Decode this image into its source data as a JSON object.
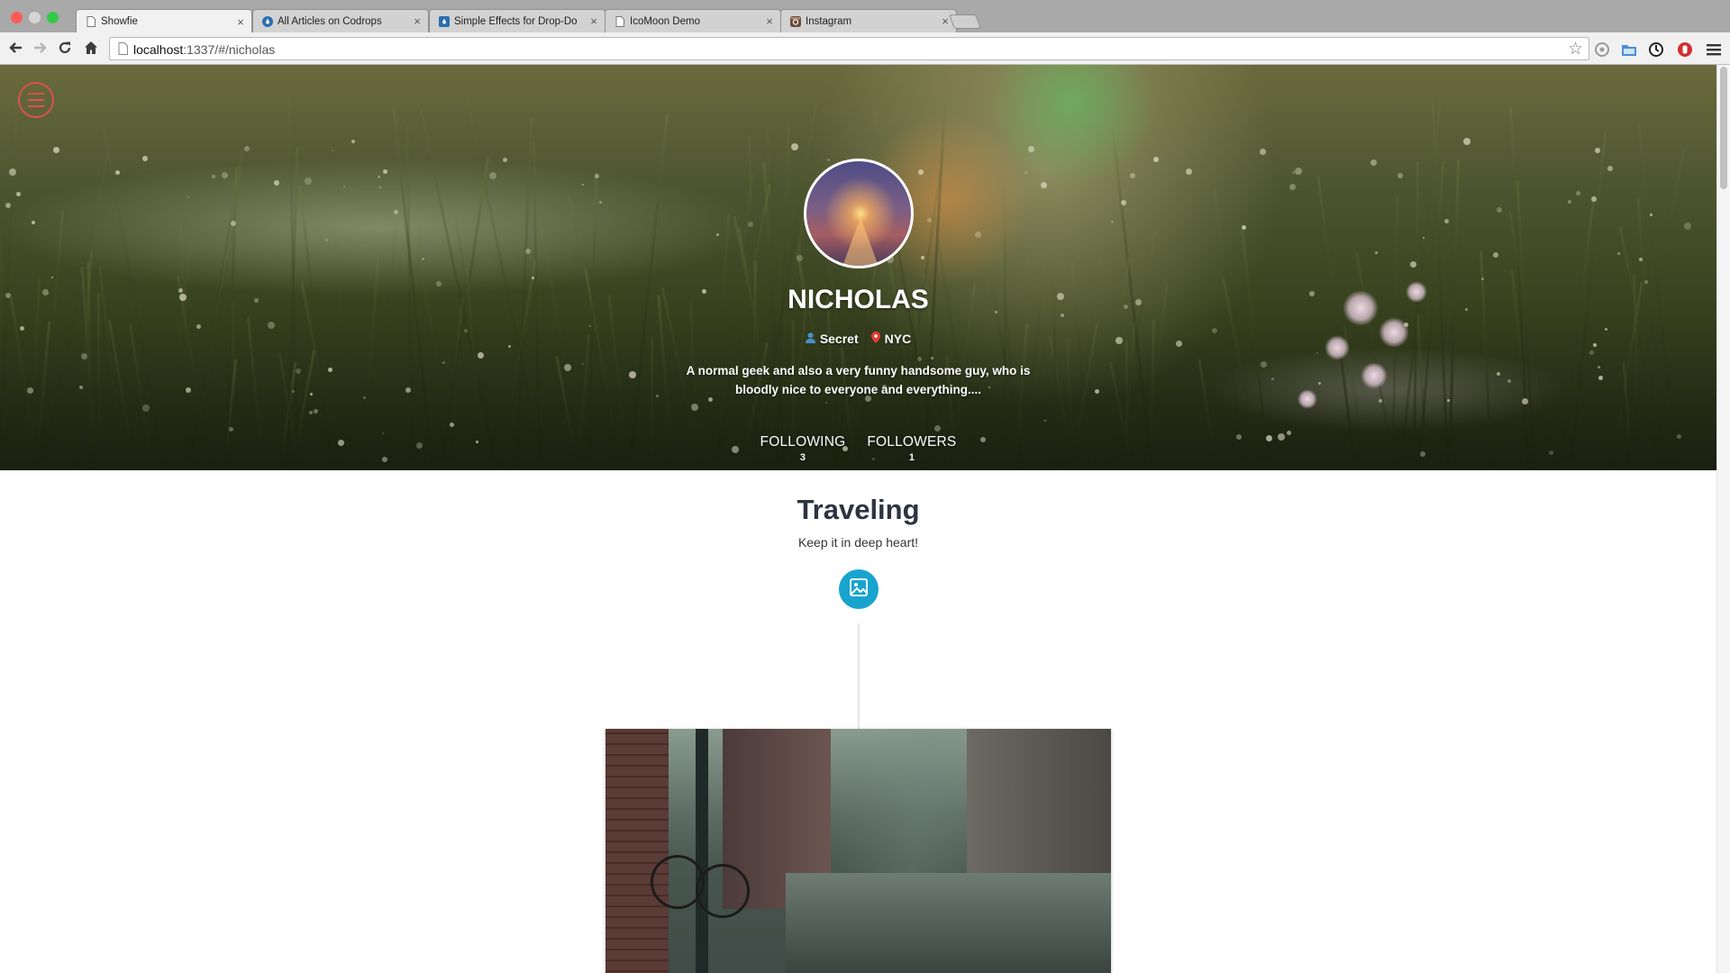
{
  "browser": {
    "tabs": [
      {
        "title": "Showfie",
        "favicon": "page-icon",
        "active": true
      },
      {
        "title": "All Articles on Codrops",
        "favicon": "codrops-drop-icon",
        "active": false
      },
      {
        "title": "Simple Effects for Drop-Do",
        "favicon": "codrops-drop-icon",
        "active": false
      },
      {
        "title": "IcoMoon Demo",
        "favicon": "page-icon",
        "active": false
      },
      {
        "title": "Instagram",
        "favicon": "instagram-icon",
        "active": false
      }
    ],
    "url_host": "localhost",
    "url_rest": ":1337/#/nicholas"
  },
  "profile": {
    "name": "NICHOLAS",
    "gender": "Secret",
    "location": "NYC",
    "bio": "A normal geek and also a very funny handsome guy, who is bloodly nice to everyone and everything....",
    "following_label": "FOLLOWING",
    "following_count": "3",
    "followers_label": "FOLLOWERS",
    "followers_count": "1"
  },
  "section": {
    "title": "Traveling",
    "subtitle": "Keep it in deep heart!"
  },
  "colors": {
    "accent": "#18a4cf",
    "menu": "#d9534f",
    "heading": "#2b3440"
  }
}
